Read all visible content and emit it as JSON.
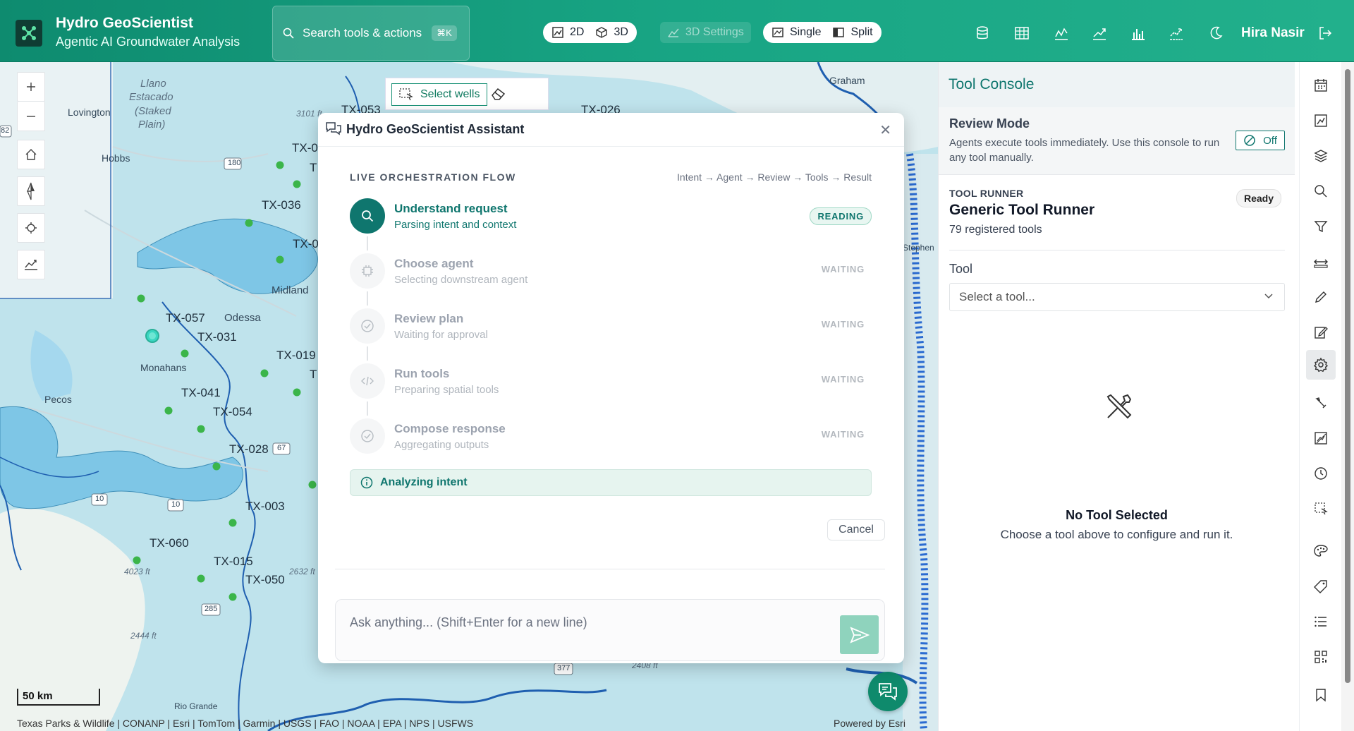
{
  "header": {
    "app_title": "Hydro GeoScientist",
    "app_subtitle": "Agentic AI Groundwater Analysis",
    "search_label": "Search tools & actions",
    "search_shortcut": "⌘K",
    "view_2d": "2D",
    "view_3d": "3D",
    "settings_3d": "3D Settings",
    "layout_single": "Single",
    "layout_split": "Split",
    "user_name": "Hira Nasir",
    "icons": [
      "database-icon",
      "table-icon",
      "line-chart-icon",
      "trend-icon",
      "bar-chart-icon",
      "forecast-icon",
      "moon-icon",
      "logout-icon"
    ]
  },
  "map": {
    "select_wells_label": "Select wells",
    "places": {
      "lovington": "Lovington",
      "hobbs": "Hobbs",
      "midland": "Midland",
      "odessa": "Odessa",
      "monahans": "Monahans",
      "pecos": "Pecos",
      "graham": "Graham",
      "rio_grande": "Rio Grande",
      "stephen": "Stephen",
      "llano": "Llano",
      "estacado": "Estacado",
      "staked": "(Staked",
      "plain": "Plain)"
    },
    "elevations": {
      "e3101": "3101 ft",
      "e4023": "4023 ft",
      "e2632": "2632 ft",
      "e2444": "2444 ft",
      "e2408": "2408 ft"
    },
    "wells": {
      "tx053": "TX-053",
      "tx026": "TX-026",
      "tx036": "TX-036",
      "tx057": "TX-057",
      "tx031": "TX-031",
      "tx019": "TX-019",
      "tx041": "TX-041",
      "tx054": "TX-054",
      "tx028": "TX-028",
      "tx003": "TX-003",
      "tx060": "TX-060",
      "tx015": "TX-015",
      "tx050": "TX-050",
      "tx_partial_a": "TX-0",
      "tx_partial_b": "TX-0",
      "t_partial_a": "T",
      "t_partial_b": "T"
    },
    "shields": {
      "s180": "180",
      "s67": "67",
      "s10a": "10",
      "s10b": "10",
      "s285": "285",
      "s377": "377",
      "s82": "82"
    },
    "scale_label": "50 km",
    "attribution": "Texas Parks & Wildlife | CONANP | Esri | TomTom | Garmin | USGS | FAO | NOAA | EPA | NPS | USFWS",
    "powered_by": "Powered by Esri",
    "colors": {
      "water": "#bfe3ec",
      "aquifer": "#7ec6e6",
      "river": "#1f5fb0",
      "well": "#3bb54a",
      "selected_well": "#3ad6c1"
    }
  },
  "assistant": {
    "title": "Hydro GeoScientist Assistant",
    "flow_title": "LIVE ORCHESTRATION FLOW",
    "flow_path": "Intent → Agent → Review → Tools → Result",
    "steps": [
      {
        "title": "Understand request",
        "subtitle": "Parsing intent and context",
        "status": "READING"
      },
      {
        "title": "Choose agent",
        "subtitle": "Selecting downstream agent",
        "status": "WAITING"
      },
      {
        "title": "Review plan",
        "subtitle": "Waiting for approval",
        "status": "WAITING"
      },
      {
        "title": "Run tools",
        "subtitle": "Preparing spatial tools",
        "status": "WAITING"
      },
      {
        "title": "Compose response",
        "subtitle": "Aggregating outputs",
        "status": "WAITING"
      }
    ],
    "status_text": "Analyzing intent",
    "cancel_label": "Cancel",
    "input_placeholder": "Ask anything...  (Shift+Enter for a new line)"
  },
  "console": {
    "title": "Tool Console",
    "review_title": "Review Mode",
    "review_desc": "Agents execute tools immediately. Use this console to run any tool manually.",
    "toggle_label": "Off",
    "runner_label": "TOOL RUNNER",
    "runner_title": "Generic Tool Runner",
    "runner_count": "79 registered tools",
    "ready_label": "Ready",
    "tool_label": "Tool",
    "tool_placeholder": "Select a tool...",
    "empty_title": "No Tool Selected",
    "empty_subtitle": "Choose a tool above to configure and run it."
  },
  "accent_color": "#0f766e"
}
